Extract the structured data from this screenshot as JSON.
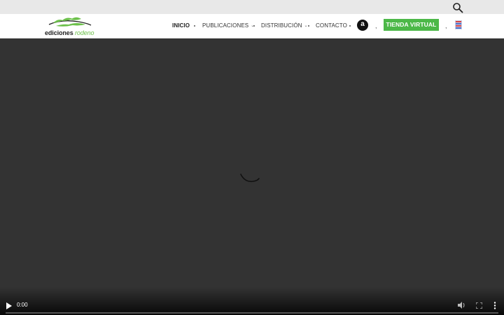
{
  "header": {
    "logo": {
      "text_main": "ediciones",
      "text_accent": "rodeno"
    },
    "nav": [
      {
        "label": "INICIO",
        "active": true,
        "has_dropdown": false
      },
      {
        "label": "PUBLICACIONES",
        "active": false,
        "has_dropdown": true
      },
      {
        "label": "DISTRIBUCIÓN",
        "active": false,
        "has_dropdown": true
      },
      {
        "label": "CONTACTO",
        "active": false,
        "has_dropdown": false
      }
    ],
    "amazon_icon": "a",
    "shop_button": "TIENDA VIRTUAL",
    "separator": ",",
    "search_icon": "search-icon",
    "flag_icon": "flag-icon"
  },
  "video": {
    "time": "0:00",
    "state": "loading",
    "progress": 0
  },
  "colors": {
    "accent": "#4cb848",
    "logo_green": "#6cc04a",
    "video_bg": "#333333",
    "topbar_bg": "#e8e8e8"
  }
}
